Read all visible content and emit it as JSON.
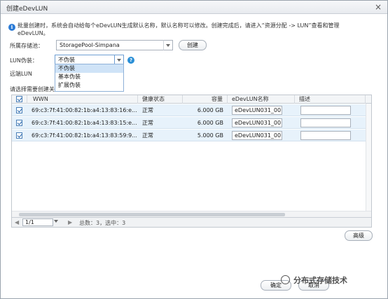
{
  "dialog": {
    "title": "创建eDevLUN",
    "close_glyph": "×"
  },
  "info": {
    "line1": "批量创建时，系统会自动给每个eDevLUN生成默认名称，默认名称可以修改。创建完成后，请进入“资源分配 -> LUN”查看和管理",
    "line2": "eDevLUN。"
  },
  "form": {
    "pool_label": "所属存储池：",
    "pool_value": "StoragePool-Simpana",
    "create_button": "创建",
    "lun_label": "LUN伪装：",
    "lun_value": "不伪装",
    "lun_options": [
      "不伪装",
      "基本伪装",
      "扩展伪装"
    ],
    "remote_label": "远端LUN",
    "select_label": "请选择需要创建关"
  },
  "table": {
    "columns": [
      "WWN",
      "健康状态",
      "容量",
      "eDevLUN名称",
      "描述"
    ],
    "rows": [
      {
        "wwn": "69:c3:7f:41:00:82:1b:a4:13:83:16:e...",
        "health": "正常",
        "capacity": "6.000 GB",
        "name": "eDevLUN031_00",
        "desc": "",
        "checked": true
      },
      {
        "wwn": "69:c3:7f:41:00:82:1b:a4:13:83:15:e...",
        "health": "正常",
        "capacity": "6.000 GB",
        "name": "eDevLUN031_00",
        "desc": "",
        "checked": true
      },
      {
        "wwn": "69:c3:7f:41:00:82:1b:a4:13:83:59:9...",
        "health": "正常",
        "capacity": "5.000 GB",
        "name": "eDevLUN031_00",
        "desc": "",
        "checked": true
      }
    ],
    "pager": {
      "page_value": "1/1",
      "summary": "总数：3，选中：3"
    }
  },
  "footer": {
    "advanced_button": "高级",
    "ok_button": "确定",
    "cancel_button": "取消"
  },
  "watermark": {
    "text": "分布式存储技术"
  },
  "colors": {
    "row_selected": "#e7f2fb",
    "accent": "#2b7bd6"
  }
}
